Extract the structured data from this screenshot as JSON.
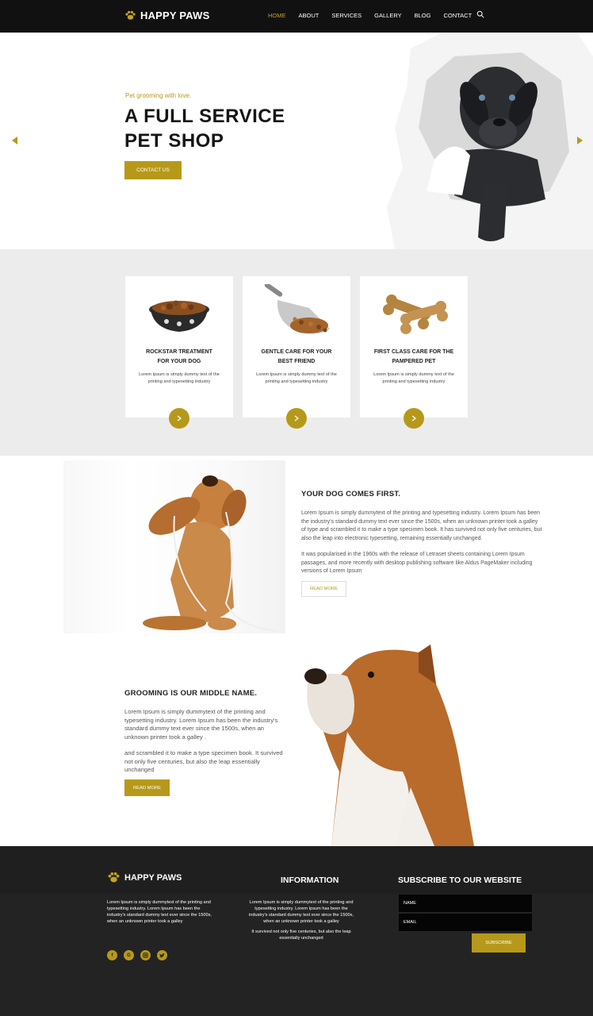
{
  "nav": {
    "brand": "HAPPY PAWS",
    "items": [
      "HOME",
      "ABOUT",
      "SERVICES",
      "GALLERY",
      "BLOG",
      "CONTACT"
    ],
    "active_index": 0
  },
  "hero": {
    "tagline": "Pet grooming with love.",
    "title_line1": "A FULL SERVICE",
    "title_line2": "PET SHOP",
    "cta": "CONTACT US"
  },
  "services": [
    {
      "title_line1": "ROCKSTAR  TREATMENT",
      "title_line2": "FOR  YOUR  DOG",
      "text": "Lorem Ipsum is simply dummy text of the printing and typesetting industry"
    },
    {
      "title_line1": "GENTLE CARE FOR YOUR",
      "title_line2": "BEST FRIEND",
      "text": "Lorem Ipsum is simply dummy text of the printing and typesetting industry"
    },
    {
      "title_line1": "FIRST CLASS CARE FOR THE",
      "title_line2": "PAMPERED PET",
      "text": "Lorem Ipsum is simply dummy text of the printing and typesetting industry"
    }
  ],
  "about1": {
    "heading": "YOUR DOG COMES FIRST.",
    "p1": "Lorem Ipsum is simply dummytext of the printing and typesetting industry. Lorem Ipsum has been the industry's standard dummy text ever since the 1500s, when an unknown printer took a galley of type and scrambled it to make a type specimen book. It has survived not only five centuries, but also the leap into electronic typesetting, remaining essentially unchanged.",
    "p2": "It was popularised in the 1960s with the release of Letraset sheets containing Lorem Ipsum passages, and more recently with desktop publishing software like Aldus PageMaker including versions of Lorem Ipsum",
    "button": "READ MORE"
  },
  "about2": {
    "heading": "GROOMING IS OUR MIDDLE NAME.",
    "p1": "Lorem Ipsum is simply dummytext of the printing and typesetting industry. Lorem Ipsum has been the industry's standard dummy text ever since the 1500s, when an unknown printer took a galley .",
    "p2": "and scrambled it to make a type specimen book. It survived not only five centuries, but also the leap essentially unchanged",
    "button": "READ MORE"
  },
  "footer": {
    "brand": "HAPPY PAWS",
    "brand_text": "Lorem Ipsum is simply dummytext of the printing and typesetting industry. Lorem Ipsum has been the industry's standard dummy text ever since the 1500s, when an unknown printer took a galley",
    "info_heading": "INFORMATION",
    "info_p1": "Lorem Ipsum is simply dummytext of the printing and typesetting industry. Lorem Ipsum has been the industry's standard dummy text ever since the 1500s, when an unknown printer took a galley",
    "info_p2": "It survived not only five centuries, but also the leap essentially unchanged",
    "subscribe_heading": "SUBSCRIBE TO OUR WEBSITE",
    "name_placeholder": "NAME",
    "email_placeholder": "EMAIL",
    "subscribe_button": "SUBSCRIBE",
    "social_icons": [
      "facebook-icon",
      "google-plus-icon",
      "instagram-icon",
      "twitter-icon"
    ]
  },
  "colors": {
    "accent": "#b6991a",
    "nav_bg": "#121112",
    "footer_bg": "#232323",
    "section_bg": "#ececec"
  }
}
